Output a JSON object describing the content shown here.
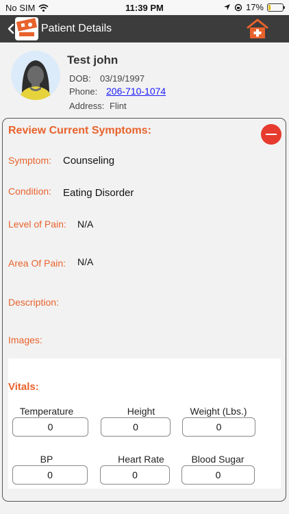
{
  "status_bar": {
    "carrier": "No SIM",
    "time": "11:39 PM",
    "battery_percent": "17%",
    "battery_level": 0.17
  },
  "nav": {
    "title": "Patient Details",
    "back_icon": "chevron-left-icon",
    "home_icon": "home-medical-icon"
  },
  "patient": {
    "name": "Test john",
    "dob_label": "DOB:",
    "dob": "03/19/1997",
    "phone_label": "Phone:",
    "phone": "206-710-1074",
    "address_label": "Address:",
    "address": "Flint"
  },
  "symptoms": {
    "title": "Review Current Symptoms:",
    "symptom_label": "Symptom:",
    "symptom": "Counseling",
    "condition_label": "Condition:",
    "condition": "Eating Disorder",
    "pain_level_label": "Level of Pain:",
    "pain_level": "N/A",
    "pain_area_label": "Area Of Pain:",
    "pain_area": "N/A",
    "description_label": "Description:",
    "images_label": "Images:"
  },
  "vitals": {
    "title": "Vitals:",
    "temperature_label": "Temperature",
    "temperature": "0",
    "height_label": "Height",
    "height": "0",
    "weight_label": "Weight (Lbs.)",
    "weight": "0",
    "bp_label": "BP",
    "bp": "0",
    "heart_rate_label": "Heart Rate",
    "heart_rate": "0",
    "blood_sugar_label": "Blood Sugar",
    "blood_sugar": "0"
  },
  "colors": {
    "accent": "#e8622c",
    "nav_bg": "#3c3c3c",
    "collapse_button": "#e63b2e",
    "link": "#1a1aff"
  }
}
